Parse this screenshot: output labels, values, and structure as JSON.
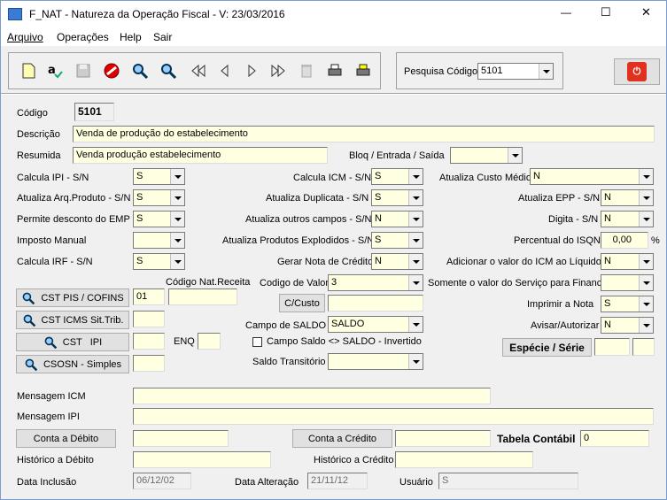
{
  "window": {
    "title": "F_NAT - Natureza da Operação Fiscal - V: 23/03/2016",
    "minimize": "—",
    "maximize": "☐",
    "close": "✕"
  },
  "menu": [
    "Arquivo",
    "Operações",
    "Help",
    "Sair"
  ],
  "toolbar": {
    "icons": [
      "new-document-icon",
      "spellcheck-icon",
      "save-icon",
      "cancel-icon",
      "search-icon",
      "search-icon",
      "first-record-icon",
      "previous-record-icon",
      "next-record-icon",
      "last-record-icon",
      "delete-icon",
      "print-icon",
      "print-preview-icon"
    ]
  },
  "search": {
    "label": "Pesquisa Código",
    "value": "5101"
  },
  "form": {
    "codigo_label": "Código",
    "codigo": "5101",
    "descricao_label": "Descrição",
    "descricao": "Venda de produção do estabelecimento",
    "resumida_label": "Resumida",
    "resumida": "Venda produção estabelecimento",
    "bloq_label": "Bloq / Entrada / Saída",
    "bloq": "",
    "calcula_ipi_label": "Calcula IPI - S/N",
    "calcula_ipi": "S",
    "calcula_icm_label": "Calcula ICM - S/N",
    "calcula_icm": "S",
    "atualiza_custo_label": "Atualiza Custo Médio",
    "atualiza_custo": "N",
    "atualiza_arq_label": "Atualiza Arq.Produto - S/N",
    "atualiza_arq": "S",
    "atualiza_dup_label": "Atualiza Duplicata - S/N",
    "atualiza_dup": "S",
    "atualiza_epp_label": "Atualiza EPP - S/N",
    "atualiza_epp": "N",
    "permite_desc_label": "Permite desconto do EMP",
    "permite_desc": "S",
    "atualiza_outros_label": "Atualiza outros campos - S/N",
    "atualiza_outros": "N",
    "digita_label": "Digita - S/N",
    "digita": "N",
    "imposto_manual_label": "Imposto Manual",
    "imposto_manual": "",
    "atualiza_expl_label": "Atualiza Produtos Explodidos - S/N",
    "atualiza_expl": "S",
    "perc_isqn_label": "Percentual do ISQN",
    "perc_isqn": "0,00",
    "perc_sign": "%",
    "calcula_irf_label": "Calcula IRF - S/N",
    "calcula_irf": "S",
    "gera_nota_label": "Gerar Nota de Crédito",
    "gera_nota": "N",
    "adicionar_icm_label": "Adicionar o valor do ICM ao Líquido",
    "adicionar_icm": "N",
    "cod_nat_label": "Código Nat.Receita",
    "cod_nat": "",
    "codigo_valor_label": "Codigo de Valor",
    "codigo_valor": "3",
    "somente_label": "Somente o valor do Serviço para Financ.",
    "somente": "",
    "cst_pis_btn": "CST PIS / COFINS",
    "cst_pis": "01",
    "c_custo_btn": "C/Custo",
    "c_custo": "",
    "imprimir_label": "Imprimir a Nota",
    "imprimir": "S",
    "cst_icms_btn": "CST ICMS Sit.Trib.",
    "cst_icms": "",
    "campo_saldo_label": "Campo de SALDO",
    "campo_saldo": "SALDO",
    "avisar_label": "Avisar/Autorizar",
    "avisar": "N",
    "cst_ipi_btn": "CST   IPI",
    "cst_ipi": "",
    "enq_label": "ENQ",
    "enq": "",
    "campo_inv_label": "Campo Saldo <> SALDO - Invertido",
    "especie_btn": "Espécie / Série",
    "especie": "",
    "serie": "",
    "csosn_btn": "CSOSN - Simples",
    "csosn": "",
    "saldo_trans_label": "Saldo Transitório",
    "saldo_trans": "",
    "msg_icm_label": "Mensagem ICM",
    "msg_icm": "",
    "msg_ipi_label": "Mensagem IPI",
    "msg_ipi": "",
    "conta_debito_btn": "Conta a Débito",
    "conta_debito": "",
    "conta_credito_btn": "Conta a Crédito",
    "conta_credito": "",
    "tabela_contabil_label": "Tabela Contábil",
    "tabela_contabil": "0",
    "hist_debito_label": "Histórico a Débito",
    "hist_debito": "",
    "hist_credito_label": "Histórico a Crédito",
    "hist_credito": "",
    "data_inclusao_label": "Data Inclusão",
    "data_inclusao": "06/12/02",
    "data_alteracao_label": "Data Alteração",
    "data_alteracao": "21/11/12",
    "usuario_label": "Usuário",
    "usuario": "S"
  }
}
